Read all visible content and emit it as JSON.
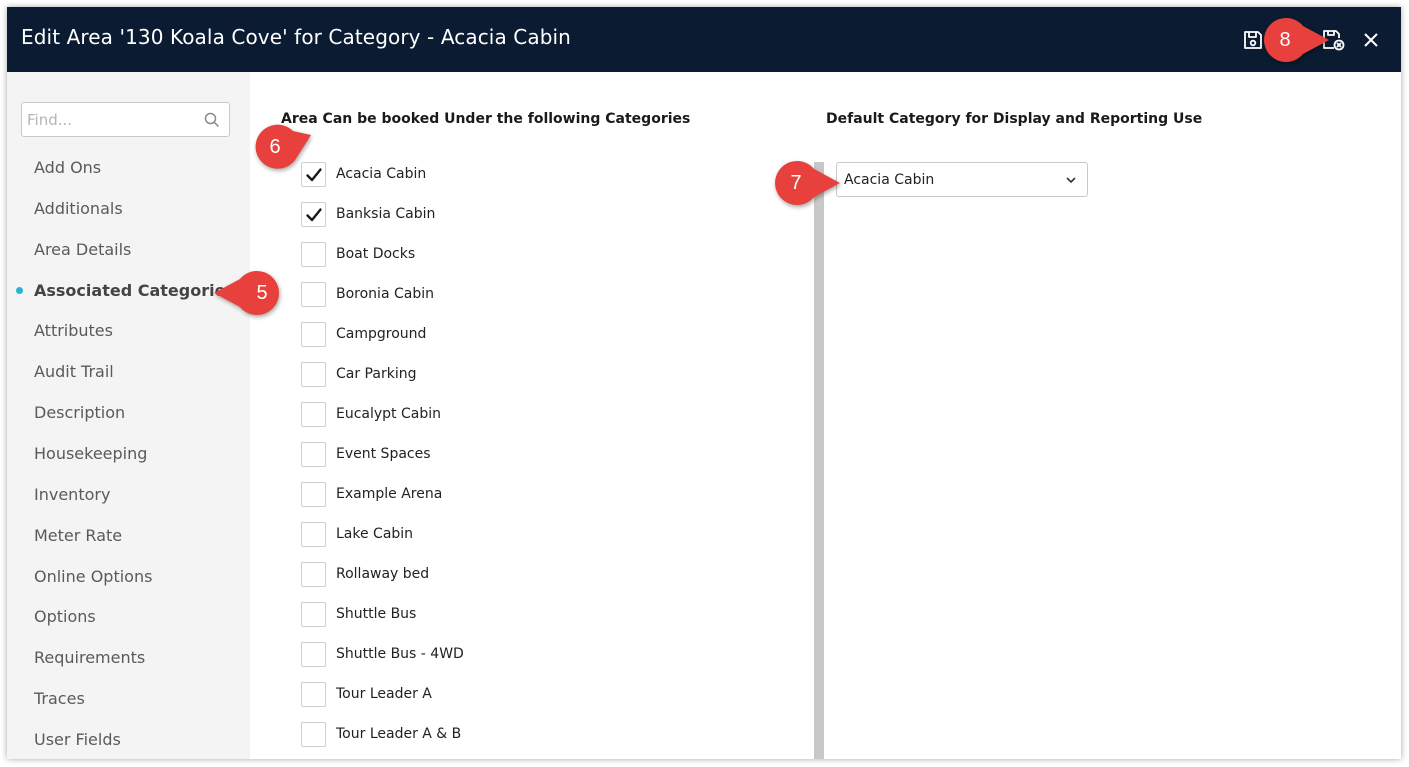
{
  "header": {
    "title": "Edit Area '130 Koala Cove' for Category - Acacia Cabin",
    "icons": [
      "save-icon",
      "save-and-close-icon",
      "close-icon"
    ]
  },
  "sidebar": {
    "search_placeholder": "Find...",
    "items": [
      {
        "label": "Add Ons",
        "active": false
      },
      {
        "label": "Additionals",
        "active": false
      },
      {
        "label": "Area Details",
        "active": false
      },
      {
        "label": "Associated Categories",
        "active": true
      },
      {
        "label": "Attributes",
        "active": false
      },
      {
        "label": "Audit Trail",
        "active": false
      },
      {
        "label": "Description",
        "active": false
      },
      {
        "label": "Housekeeping",
        "active": false
      },
      {
        "label": "Inventory",
        "active": false
      },
      {
        "label": "Meter Rate",
        "active": false
      },
      {
        "label": "Online Options",
        "active": false
      },
      {
        "label": "Options",
        "active": false
      },
      {
        "label": "Requirements",
        "active": false
      },
      {
        "label": "Traces",
        "active": false
      },
      {
        "label": "User Fields",
        "active": false
      }
    ]
  },
  "categories": {
    "heading": "Area Can be booked Under the following Categories",
    "items": [
      {
        "label": "Acacia Cabin",
        "checked": true
      },
      {
        "label": "Banksia Cabin",
        "checked": true
      },
      {
        "label": "Boat Docks",
        "checked": false
      },
      {
        "label": "Boronia Cabin",
        "checked": false
      },
      {
        "label": "Campground",
        "checked": false
      },
      {
        "label": "Car Parking",
        "checked": false
      },
      {
        "label": "Eucalypt Cabin",
        "checked": false
      },
      {
        "label": "Event Spaces",
        "checked": false
      },
      {
        "label": "Example Arena",
        "checked": false
      },
      {
        "label": "Lake Cabin",
        "checked": false
      },
      {
        "label": "Rollaway bed",
        "checked": false
      },
      {
        "label": "Shuttle Bus",
        "checked": false
      },
      {
        "label": "Shuttle Bus - 4WD",
        "checked": false
      },
      {
        "label": "Tour Leader A",
        "checked": false
      },
      {
        "label": "Tour Leader A & B",
        "checked": false
      }
    ]
  },
  "default_category": {
    "heading": "Default Category for Display and Reporting Use",
    "selected": "Acacia Cabin"
  },
  "callouts": {
    "c5": "5",
    "c6": "6",
    "c7": "7",
    "c8": "8"
  },
  "colors": {
    "header_bg": "#0b1c32",
    "callout": "#e8403c",
    "active_dot": "#23b5d3"
  }
}
